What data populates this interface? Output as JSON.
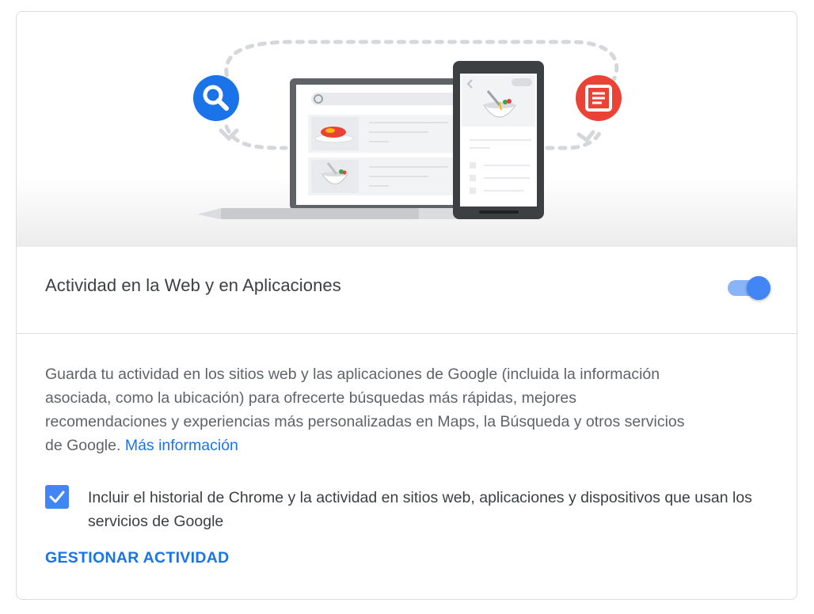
{
  "illustration": {
    "search_icon": "search-icon",
    "article_icon": "article-icon",
    "devices": "laptop-and-phone-illustration",
    "colors": {
      "blue": "#1a73e8",
      "red": "#ea4335",
      "gray": "#5f6368"
    }
  },
  "setting": {
    "title": "Actividad en la Web y en Aplicaciones",
    "enabled": true,
    "accent": "#4285f4"
  },
  "description": {
    "text": "Guarda tu actividad en los sitios web y las aplicaciones de Google (incluida la información asociada, como la ubicación) para ofrecerte búsquedas más rápidas, mejores recomendaciones y experiencias más personalizadas en Maps, la Búsqueda y otros servicios de Google.",
    "link": "Más información"
  },
  "chrome_history": {
    "checked": true,
    "label": "Incluir el historial de Chrome y la actividad en sitios web, aplicaciones y dispositivos que usan los servicios de Google"
  },
  "manage": {
    "label": "GESTIONAR ACTIVIDAD"
  }
}
